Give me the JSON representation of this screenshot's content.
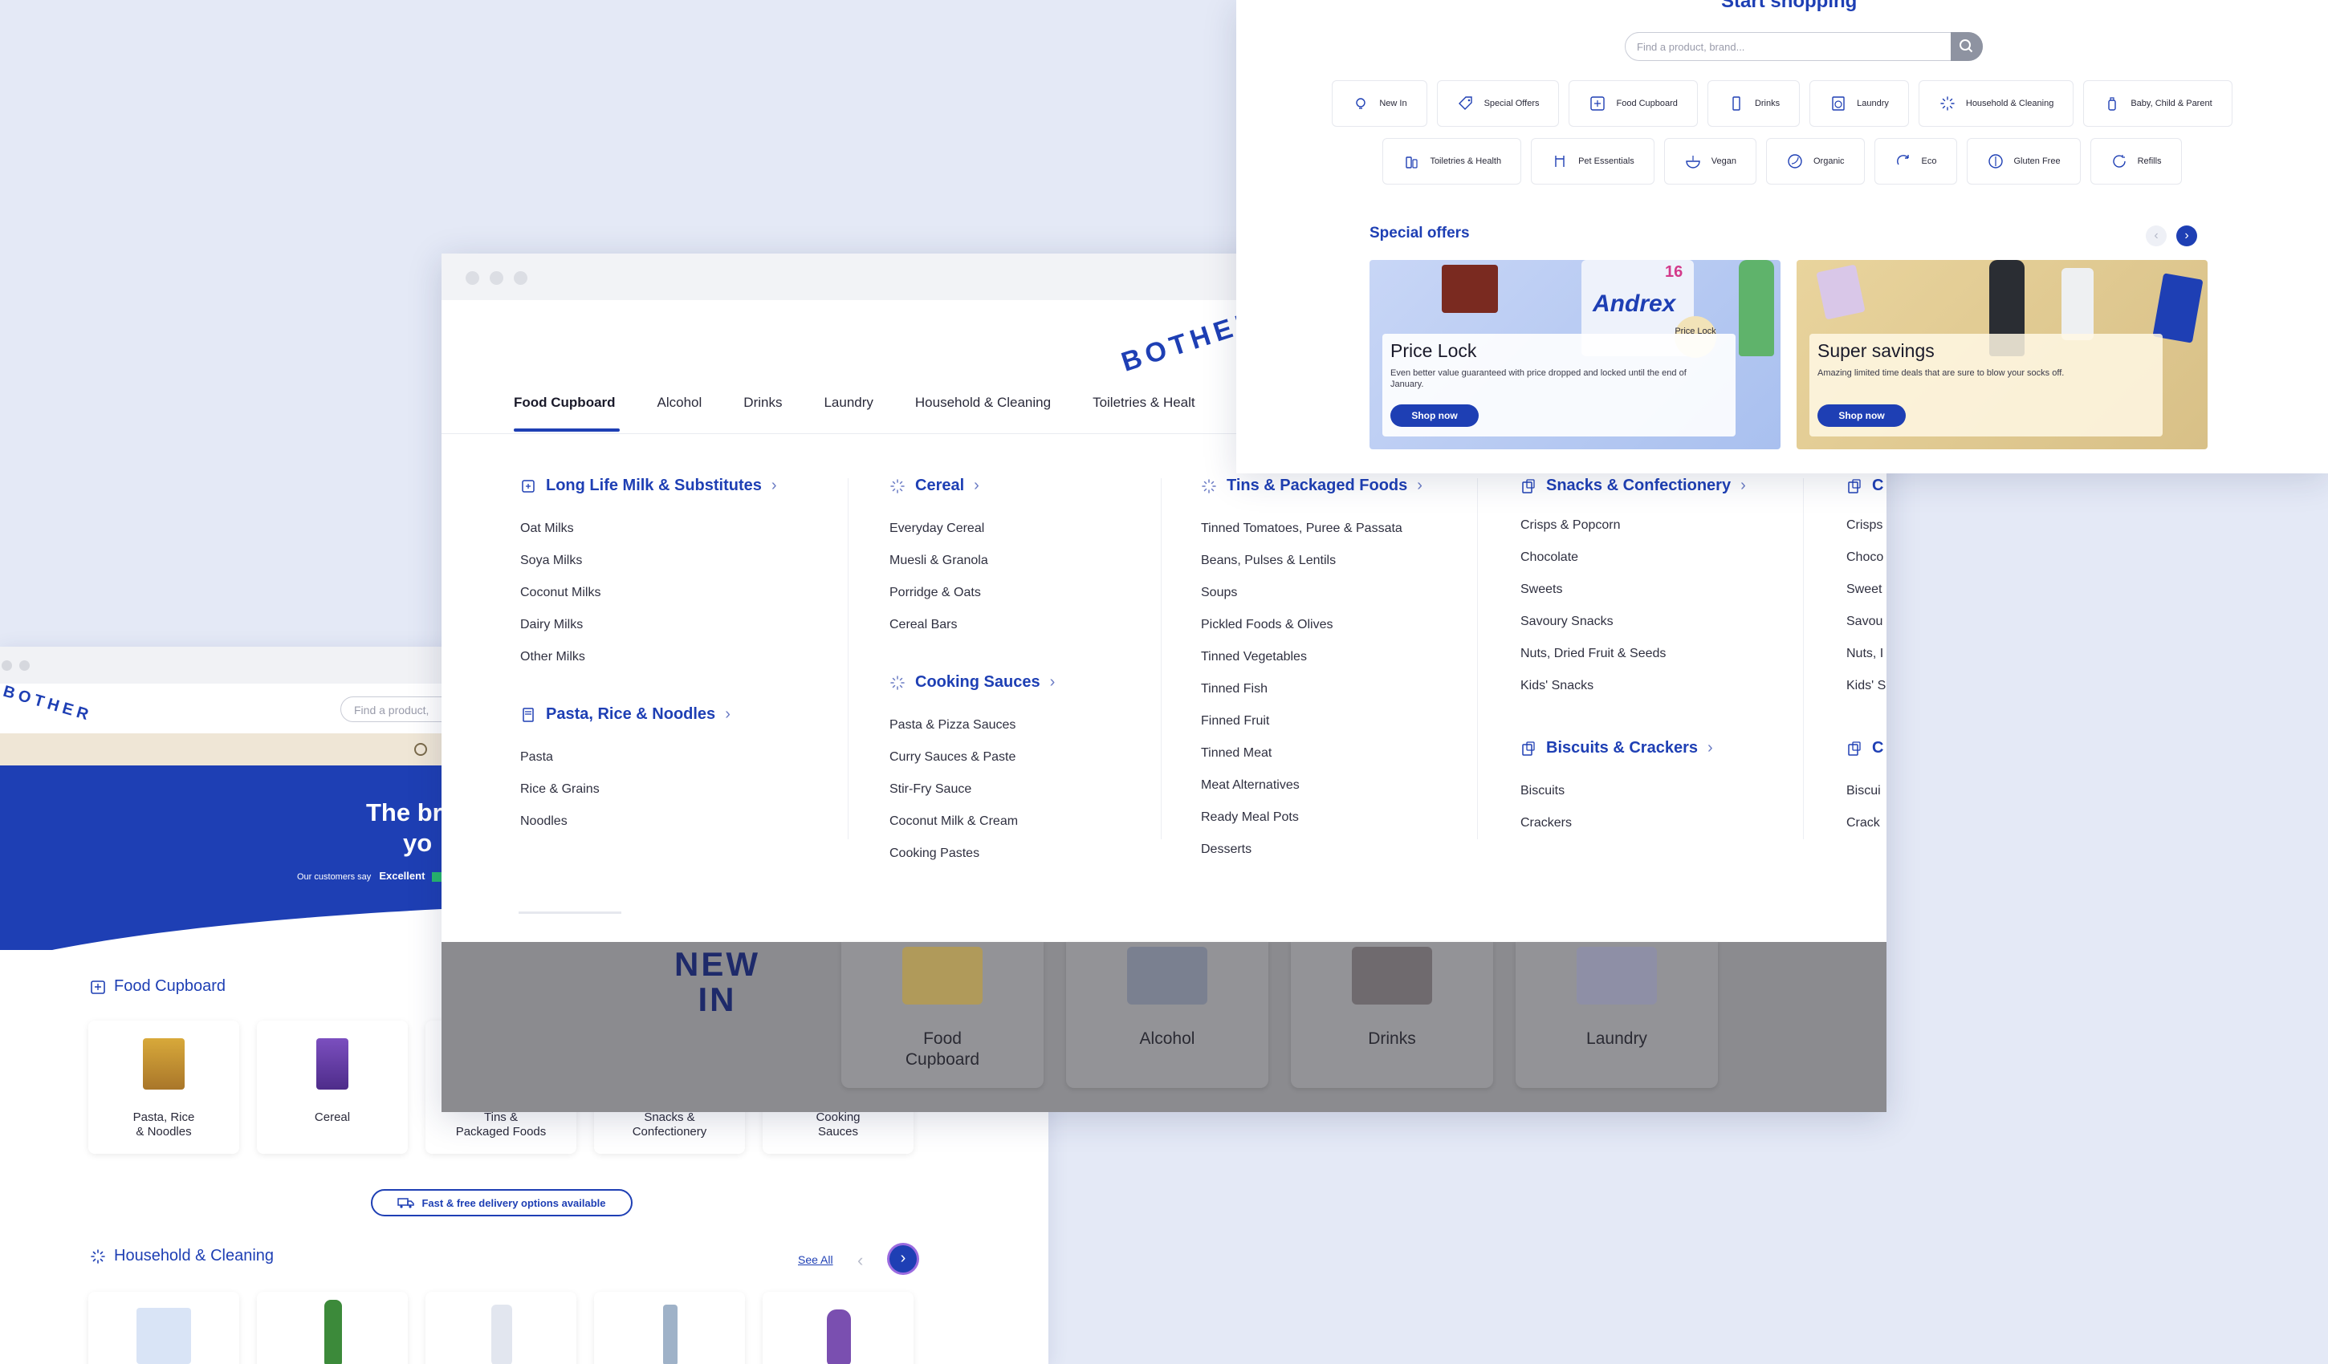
{
  "colors": {
    "brand_blue": "#1e3fb4",
    "background": "#e4e9f6",
    "overlay_grey": "#8b8b8f"
  },
  "home_window": {
    "search_placeholder": "Find a product,",
    "hero_title_line1": "The br",
    "hero_title_line2": "yo",
    "rating_prefix": "Our customers say",
    "rating_value": "Excellent",
    "food_section_title": "Food Cupboard",
    "food_cards": [
      {
        "label_line1": "Pasta, Rice",
        "label_line2": "& Noodles",
        "icon": "pasta-bag-icon"
      },
      {
        "label_line1": "Cereal",
        "label_line2": "",
        "icon": "cereal-box-icon"
      },
      {
        "label_line1": "Tins &",
        "label_line2": "Packaged Foods",
        "icon": "tin-icon"
      },
      {
        "label_line1": "Snacks &",
        "label_line2": "Confectionery",
        "icon": "snack-icon"
      },
      {
        "label_line1": "Cooking",
        "label_line2": "Sauces",
        "icon": "sauce-icon"
      }
    ],
    "delivery_text": "Fast & free delivery options available",
    "household_section_title": "Household & Cleaning",
    "see_all": "See All"
  },
  "menu_window": {
    "nav": [
      "Food Cupboard",
      "Alcohol",
      "Drinks",
      "Laundry",
      "Household & Cleaning",
      "Toiletries & Healt"
    ],
    "columns": [
      {
        "groups": [
          {
            "title": "Long Life Milk & Substitutes",
            "icon": "milk-carton-icon",
            "items": [
              "Oat Milks",
              "Soya Milks",
              "Coconut Milks",
              "Dairy Milks",
              "Other Milks"
            ]
          },
          {
            "title": "Pasta, Rice & Noodles",
            "icon": "pasta-icon",
            "items": [
              "Pasta",
              "Rice & Grains",
              "Noodles"
            ]
          }
        ]
      },
      {
        "groups": [
          {
            "title": "Cereal",
            "icon": "sparkle-icon",
            "items": [
              "Everyday Cereal",
              "Muesli & Granola",
              "Porridge & Oats",
              "Cereal Bars"
            ]
          },
          {
            "title": "Cooking Sauces",
            "icon": "sparkle-icon",
            "items": [
              "Pasta & Pizza Sauces",
              "Curry Sauces & Paste",
              "Stir-Fry Sauce",
              "Coconut Milk & Cream",
              "Cooking Pastes"
            ]
          }
        ]
      },
      {
        "groups": [
          {
            "title": "Tins & Packaged Foods",
            "icon": "sparkle-icon",
            "items": [
              "Tinned Tomatoes, Puree & Passata",
              "Beans, Pulses & Lentils",
              "Soups",
              "Pickled Foods & Olives",
              "Tinned Vegetables",
              "Tinned Fish",
              "Finned Fruit",
              "Tinned Meat",
              "Meat Alternatives",
              "Ready Meal Pots",
              "Desserts"
            ]
          }
        ]
      },
      {
        "groups": [
          {
            "title": "Snacks & Confectionery",
            "icon": "snack-jar-icon",
            "items": [
              "Crisps & Popcorn",
              "Chocolate",
              "Sweets",
              "Savoury Snacks",
              "Nuts, Dried Fruit & Seeds",
              "Kids' Snacks"
            ]
          },
          {
            "title": "Biscuits & Crackers",
            "icon": "snack-jar-icon",
            "items": [
              "Biscuits",
              "Crackers"
            ]
          }
        ]
      },
      {
        "groups": [
          {
            "title": "C",
            "icon": "snack-jar-icon",
            "items": [
              "Crisps",
              "Choco",
              "Sweet",
              "Savou",
              "Nuts, I",
              "Kids' S"
            ]
          },
          {
            "title": "C",
            "icon": "snack-jar-icon",
            "items": [
              "Biscui",
              "Crack"
            ]
          }
        ]
      }
    ],
    "shaded_tiles": {
      "new_in_line1": "NEW",
      "new_in_line2": "IN",
      "tiles": [
        {
          "label_line1": "Food",
          "label_line2": "Cupboard"
        },
        {
          "label_line1": "Alcohol",
          "label_line2": ""
        },
        {
          "label_line1": "Drinks",
          "label_line2": ""
        },
        {
          "label_line1": "Laundry",
          "label_line2": ""
        }
      ]
    }
  },
  "shop_window": {
    "title": "Start shopping",
    "search_placeholder": "Find a product, brand...",
    "chips_row1": [
      {
        "label": "New In",
        "icon": "bulb-icon"
      },
      {
        "label": "Special Offers",
        "icon": "tag-icon"
      },
      {
        "label": "Food Cupboard",
        "icon": "cupboard-icon"
      },
      {
        "label": "Drinks",
        "icon": "bottle-icon"
      },
      {
        "label": "Laundry",
        "icon": "washing-machine-icon"
      },
      {
        "label": "Household & Cleaning",
        "icon": "sparkle-icon"
      },
      {
        "label": "Baby, Child & Parent",
        "icon": "baby-bottle-icon"
      }
    ],
    "chips_row2": [
      {
        "label": "Toiletries & Health",
        "icon": "toiletries-icon"
      },
      {
        "label": "Pet Essentials",
        "icon": "pet-icon"
      },
      {
        "label": "Vegan",
        "icon": "vegan-bowl-icon"
      },
      {
        "label": "Organic",
        "icon": "organic-leaf-icon"
      },
      {
        "label": "Eco",
        "icon": "eco-icon"
      },
      {
        "label": "Gluten Free",
        "icon": "gluten-free-icon"
      },
      {
        "label": "Refills",
        "icon": "refill-icon"
      }
    ],
    "offers_title": "Special offers",
    "promos": [
      {
        "title": "Price Lock",
        "description": "Even better value guaranteed with price dropped and locked until the end of January.",
        "button": "Shop now",
        "badge": "Price Lock",
        "brand_text": "Andrex",
        "count": "16"
      },
      {
        "title": "Super savings",
        "description": "Amazing limited time deals that are sure to blow your socks off.",
        "button": "Shop now"
      }
    ]
  }
}
